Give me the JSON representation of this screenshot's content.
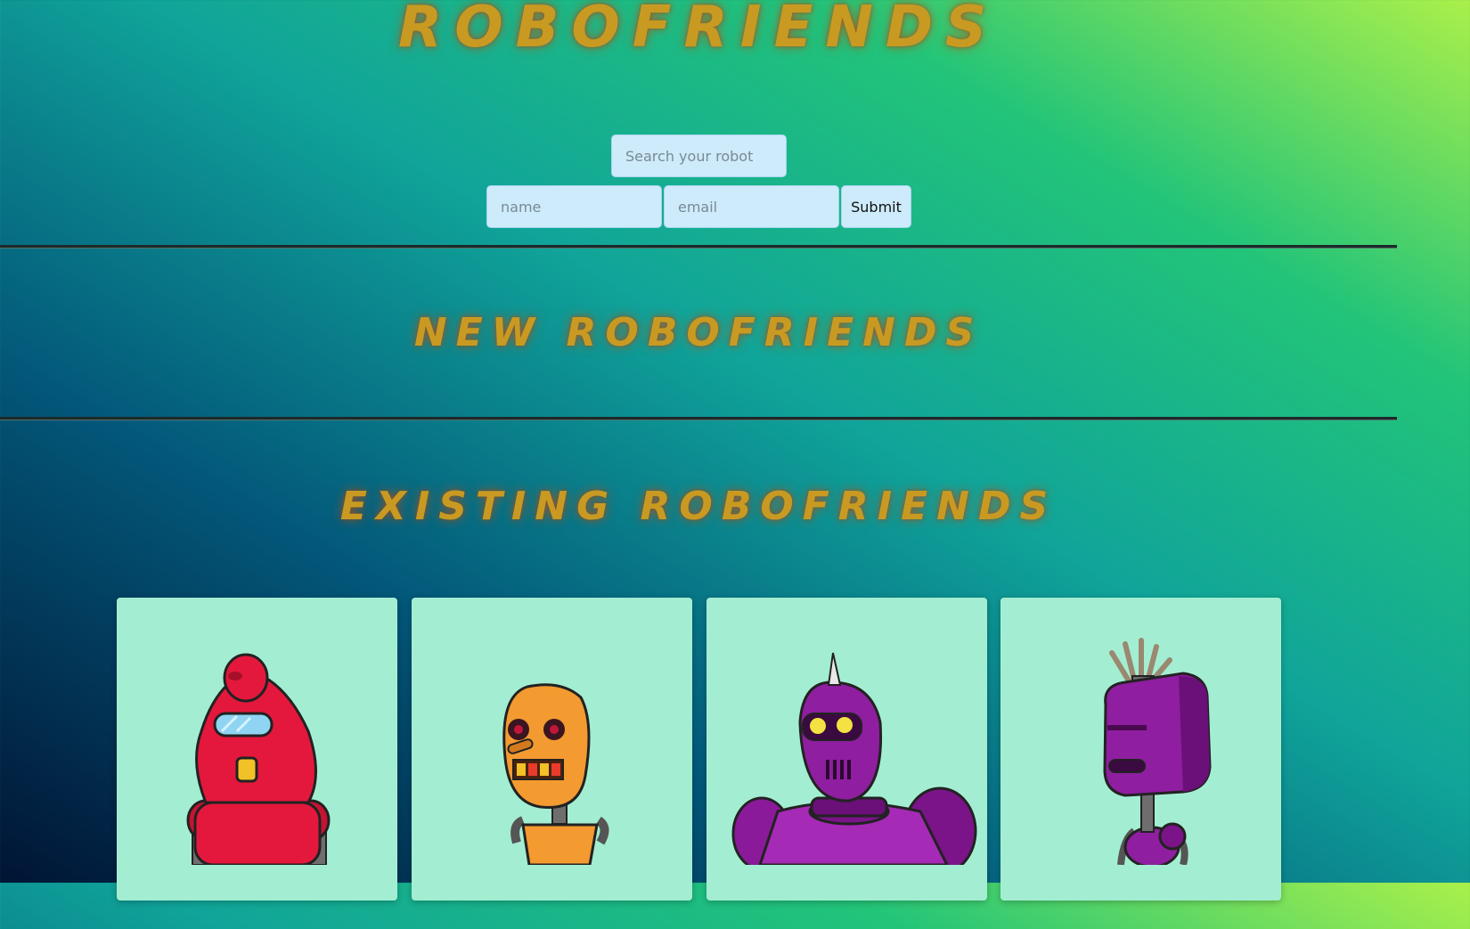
{
  "header": {
    "title": "ROBOFRIENDS"
  },
  "search": {
    "placeholder": "Search your robot"
  },
  "form": {
    "name_placeholder": "name",
    "email_placeholder": "email",
    "submit_label": "Submit"
  },
  "sections": {
    "new_title": "NEW ROBOFRIENDS",
    "existing_title": "EXISTING ROBOFRIENDS"
  },
  "colors": {
    "title": "#c99a22",
    "card": "#a3eed2",
    "input": "#cdebfb"
  },
  "robots": [
    {
      "icon": "red-robot-icon"
    },
    {
      "icon": "orange-robot-icon"
    },
    {
      "icon": "purple-horned-robot-icon"
    },
    {
      "icon": "purple-antenna-robot-icon"
    }
  ]
}
